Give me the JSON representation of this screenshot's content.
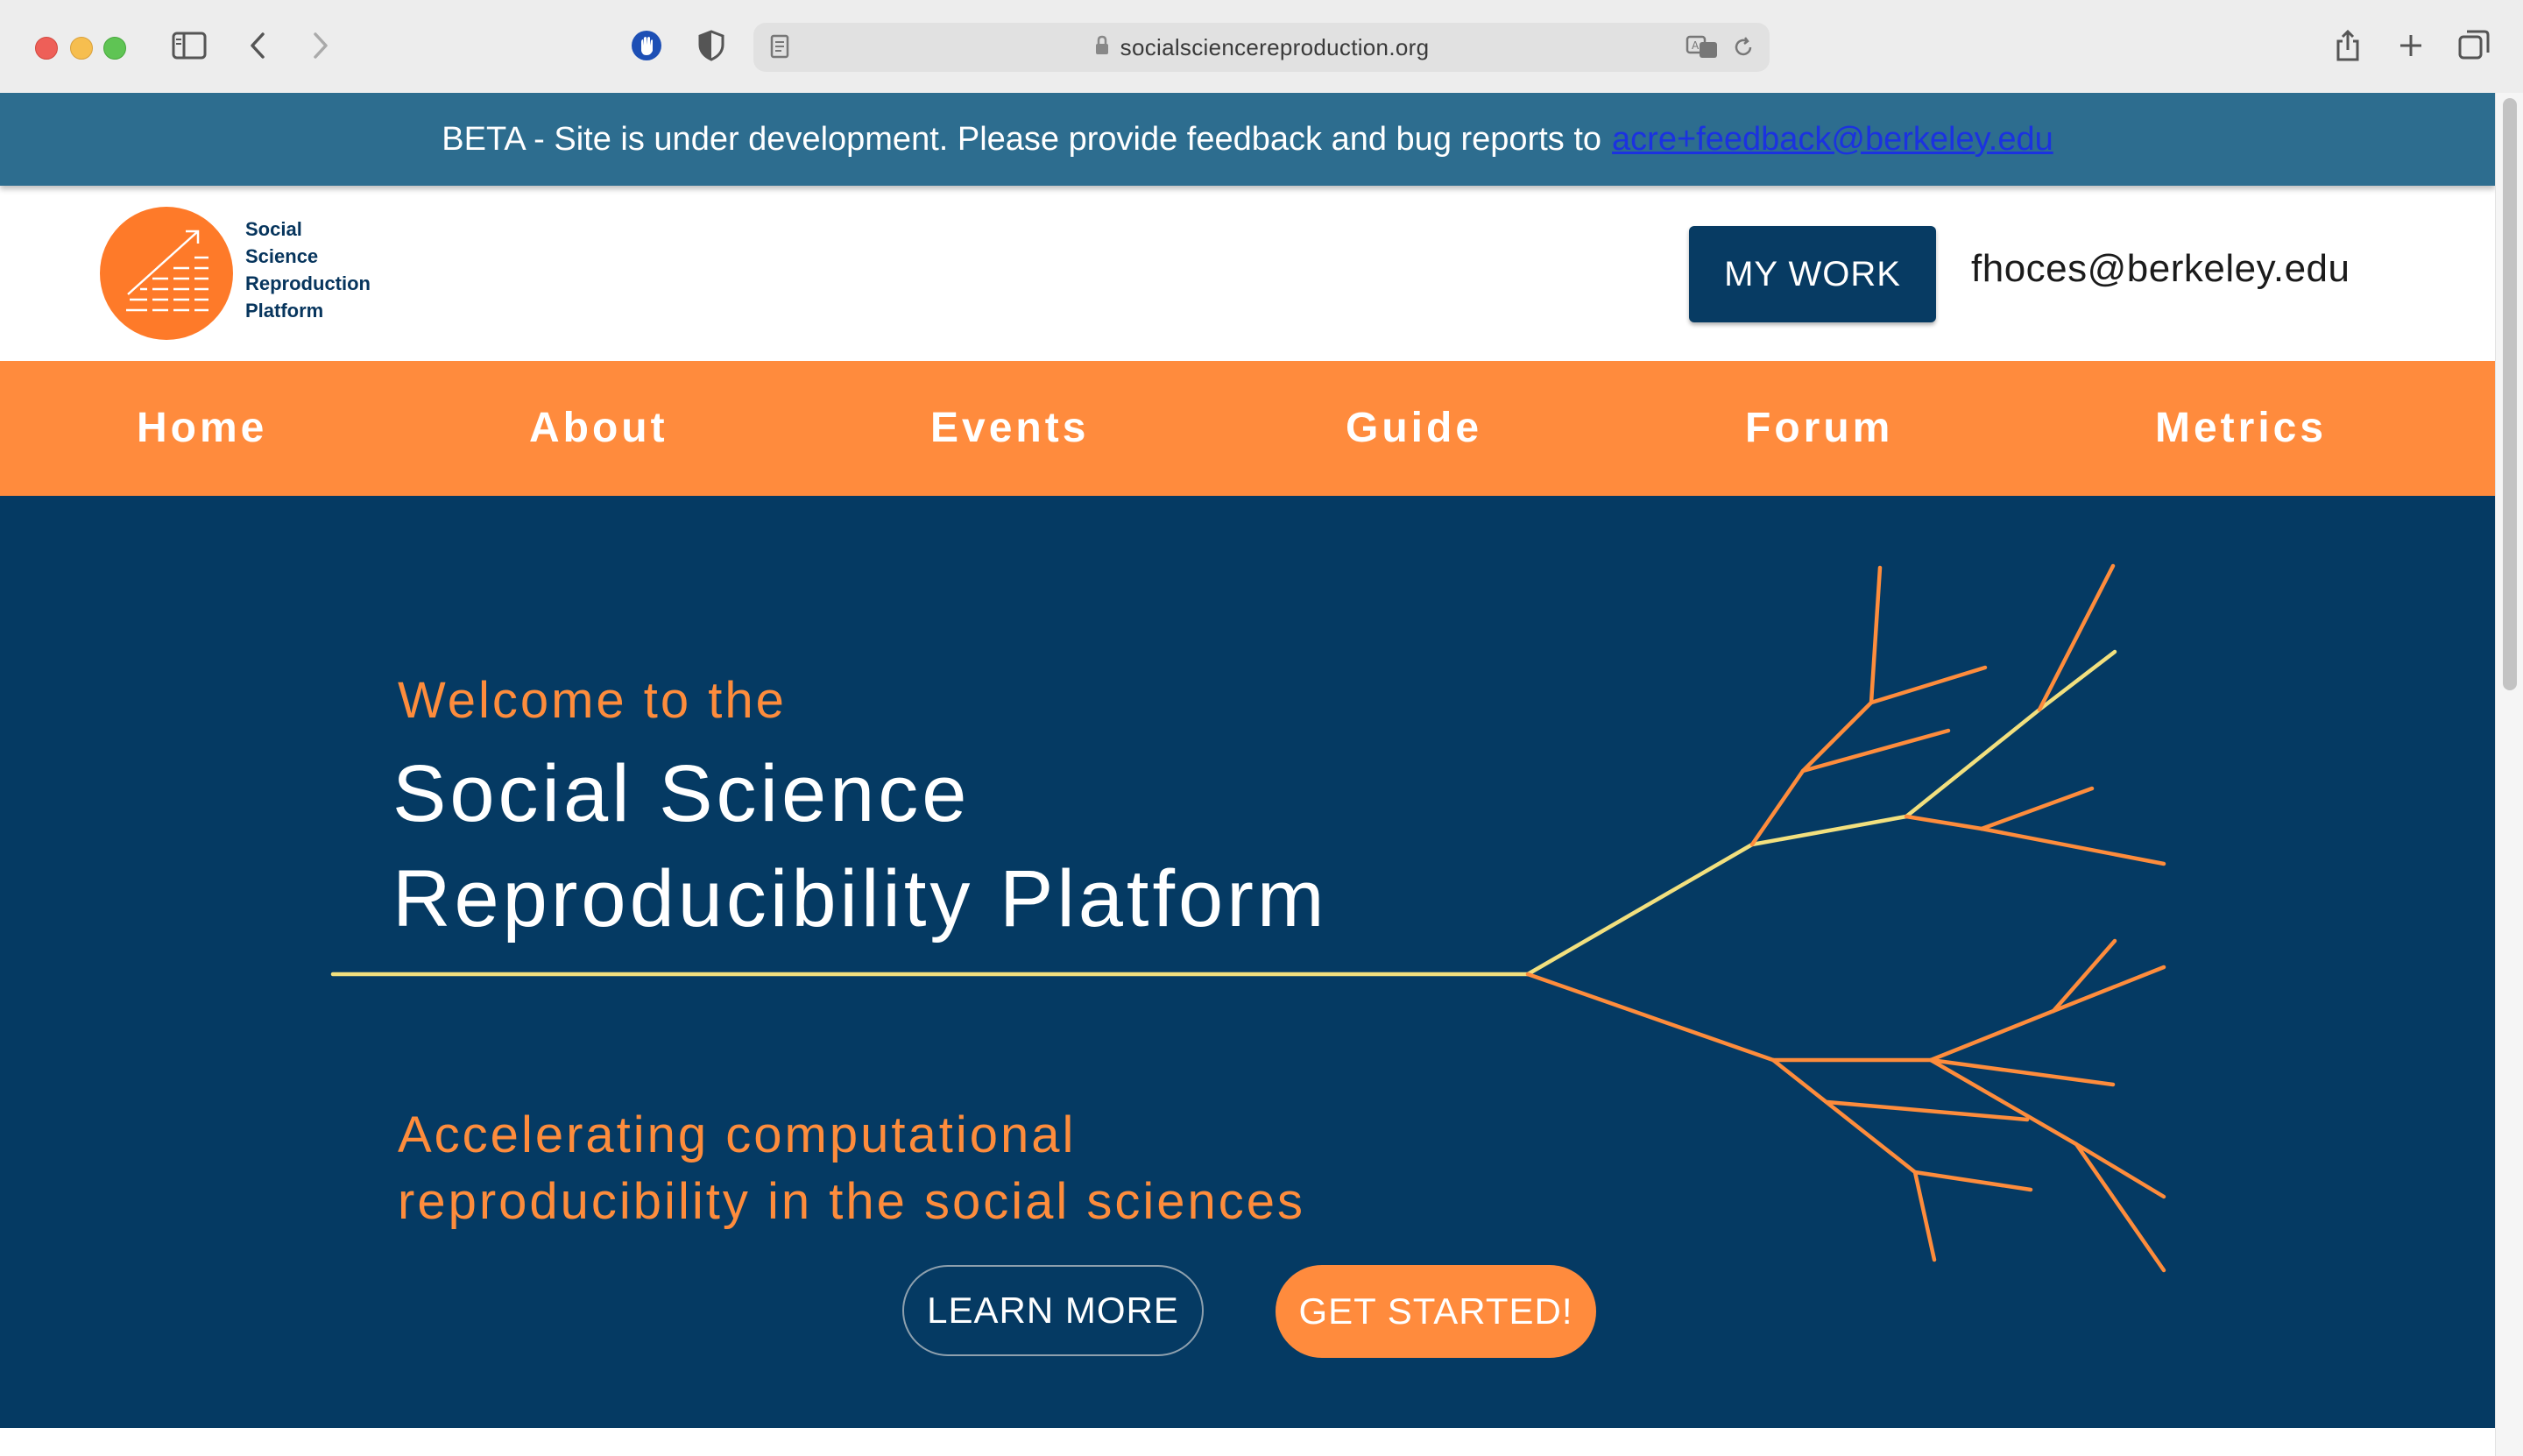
{
  "browser": {
    "url": "socialsciencereproduction.org",
    "icons": [
      "sidebar-icon",
      "back-icon",
      "forward-icon",
      "extension-icon",
      "privacy-shield-icon",
      "reader-icon",
      "lock-icon",
      "translate-icon",
      "reload-icon",
      "share-icon",
      "new-tab-icon",
      "tab-overview-icon"
    ]
  },
  "banner": {
    "text": "BETA - Site is under development. Please provide feedback and bug reports to",
    "email": "acre+feedback@berkeley.edu",
    "background": "#2d6d8f"
  },
  "header": {
    "logo_lines": [
      "Social",
      "Science",
      "Reproduction",
      "Platform"
    ],
    "my_work_label": "MY WORK",
    "user_email": "fhoces@berkeley.edu"
  },
  "nav": {
    "items": [
      "Home",
      "About",
      "Events",
      "Guide",
      "Forum",
      "Metrics"
    ],
    "background": "#ff8b3d"
  },
  "hero": {
    "welcome": "Welcome to the",
    "title_line1": "Social Science",
    "title_line2": "Reproducibility Platform",
    "subtitle_line1": "Accelerating computational",
    "subtitle_line2": "reproducibility in the social sciences",
    "learn_more_label": "LEARN MORE",
    "get_started_label": "GET STARTED!",
    "background": "#053a63",
    "accent": "#fe8c3c",
    "highlight": "#f2e07e"
  }
}
